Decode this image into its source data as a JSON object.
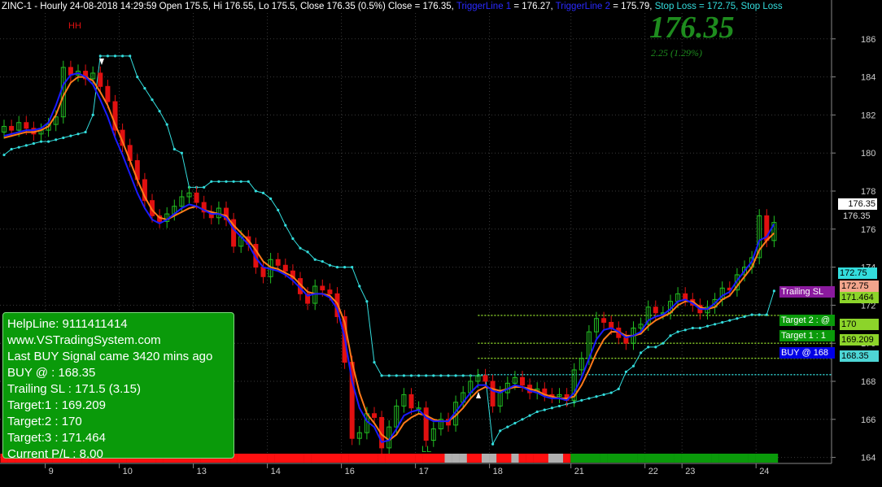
{
  "header": {
    "symbol_info": "ZINC-1 - Hourly 24-08-2018 14:29:59 Open 175.5, Hi 176.55, Lo 175.5, Close 176.35 (0.5%) Close = 176.35, ",
    "tl1_label": "TriggerLine 1",
    "tl1_value": " = 176.27, ",
    "tl2_label": "TriggerLine 2",
    "tl2_value": " = 175.79, ",
    "sl_text": "Stop Loss = 172.75, Stop Loss"
  },
  "price": {
    "last": "176.35",
    "change": "2.25  (1.29%)"
  },
  "info": {
    "helpline": "HelpLine: 9111411414",
    "website": "www.VSTradingSystem.com",
    "signal": " Last BUY Signal came 3420 mins ago",
    "buy": " BUY @  : 168.35",
    "trailing": " Trailing SL : 171.5 (3.15)",
    "target1": " Target:1 : 169.209",
    "target2": " Target:2 : 170",
    "target3": " Target:3 : 171.464",
    "pl": " Current P/L : 8.00"
  },
  "tags": {
    "price_box": "176.35",
    "price_right": "176.35",
    "stop_loss": "172.75",
    "sl2": "172.75",
    "trailing_value": "171.464",
    "trailing_label": "Trailing SL",
    "target2_label": "Target 2 : @",
    "target2_value": "170",
    "target1_label": "Target 1 : 1",
    "target1_value": "169.209",
    "buy_label": "BUY @ 168",
    "buy_value": "168.35"
  },
  "marks": {
    "hh": "HH",
    "ll": "LL"
  },
  "colors": {
    "up": "#22c022",
    "down": "#e01010",
    "trigger1": "#1a1aff",
    "trigger2": "#ff7a1a",
    "stop": "#33dddd",
    "level": "#8cd42a",
    "trailing": "#8b1a9e",
    "buybox": "#0000e6",
    "infobox": "#0a9a0a"
  },
  "chart_data": {
    "type": "candlestick",
    "ylim": [
      163,
      186.5
    ],
    "y_ticks": [
      164,
      166,
      168,
      170,
      172,
      174,
      176,
      178,
      180,
      182,
      184,
      186
    ],
    "x_ticks": [
      {
        "label": "9",
        "i": 6
      },
      {
        "label": "10",
        "i": 16
      },
      {
        "label": "13",
        "i": 26
      },
      {
        "label": "14",
        "i": 36
      },
      {
        "label": "16",
        "i": 46
      },
      {
        "label": "17",
        "i": 56
      },
      {
        "label": "18",
        "i": 66
      },
      {
        "label": "21",
        "i": 77
      },
      {
        "label": "22",
        "i": 87
      },
      {
        "label": "23",
        "i": 92
      },
      {
        "label": "24",
        "i": 102
      }
    ],
    "closes": [
      181.4,
      181.2,
      181.6,
      181.3,
      181.0,
      181.2,
      181.5,
      181.9,
      184.5,
      184.1,
      184.3,
      183.9,
      184.2,
      183.5,
      182.7,
      181.2,
      180.4,
      179.6,
      178.6,
      177.5,
      176.7,
      176.4,
      176.8,
      177.2,
      177.7,
      177.9,
      177.4,
      176.9,
      176.6,
      177.1,
      176.5,
      175.1,
      175.6,
      175.2,
      174.0,
      173.5,
      174.4,
      174.1,
      173.8,
      173.4,
      172.6,
      172.1,
      173.0,
      172.8,
      172.6,
      171.4,
      169.0,
      165.0,
      165.3,
      166.3,
      166.1,
      164.5,
      165.6,
      166.7,
      167.3,
      166.6,
      166.6,
      164.9,
      165.5,
      166.0,
      165.7,
      166.9,
      167.4,
      168.0,
      168.3,
      168.0,
      166.7,
      167.4,
      167.9,
      168.2,
      167.8,
      167.4,
      167.6,
      167.3,
      167.2,
      167.3,
      167.0,
      168.6,
      169.2,
      170.6,
      171.3,
      171.1,
      170.8,
      170.3,
      170.0,
      170.8,
      171.0,
      171.9,
      171.6,
      171.6,
      172.2,
      172.6,
      172.3,
      172.0,
      171.6,
      171.9,
      172.3,
      172.9,
      172.8,
      173.6,
      174.0,
      174.5,
      176.7,
      175.4,
      176.35
    ],
    "trigger1": [
      180.9,
      181.0,
      181.1,
      181.2,
      181.2,
      181.3,
      181.6,
      182.5,
      183.6,
      184.1,
      184.2,
      184.0,
      183.6,
      182.8,
      181.9,
      180.8,
      179.9,
      178.9,
      177.9,
      177.1,
      176.5,
      176.3,
      176.5,
      176.8,
      177.1,
      177.3,
      177.2,
      177.0,
      176.8,
      176.8,
      176.6,
      176.0,
      175.6,
      175.2,
      174.5,
      174.0,
      173.9,
      173.8,
      173.6,
      173.3,
      172.9,
      172.5,
      172.6,
      172.6,
      172.4,
      171.8,
      170.3,
      168.0,
      166.6,
      165.9,
      165.6,
      164.8,
      164.9,
      165.5,
      166.2,
      166.4,
      166.5,
      166.1,
      165.9,
      165.9,
      165.9,
      166.4,
      166.9,
      167.4,
      167.8,
      167.8,
      167.5,
      167.4,
      167.6,
      167.8,
      167.7,
      167.5,
      167.4,
      167.2,
      167.1,
      167.1,
      167.0,
      167.4,
      168.2,
      169.2,
      170.2,
      170.7,
      170.8,
      170.6,
      170.3,
      170.4,
      170.6,
      171.2,
      171.4,
      171.5,
      171.8,
      172.2,
      172.3,
      172.1,
      171.8,
      171.8,
      172.1,
      172.5,
      172.7,
      173.3,
      173.8,
      174.3,
      175.4,
      175.6,
      176.27
    ],
    "trigger2": [
      180.8,
      180.9,
      181.0,
      181.1,
      181.1,
      181.2,
      181.4,
      182.0,
      183.0,
      183.7,
      184.0,
      184.0,
      183.8,
      183.2,
      182.5,
      181.5,
      180.6,
      179.6,
      178.6,
      177.7,
      177.0,
      176.6,
      176.5,
      176.7,
      176.9,
      177.1,
      177.2,
      177.0,
      176.9,
      176.8,
      176.7,
      176.2,
      175.8,
      175.4,
      174.9,
      174.3,
      174.0,
      173.9,
      173.7,
      173.5,
      173.1,
      172.7,
      172.6,
      172.6,
      172.5,
      172.1,
      171.1,
      169.0,
      167.4,
      166.3,
      165.8,
      165.2,
      164.9,
      165.2,
      165.8,
      166.1,
      166.3,
      166.2,
      166.0,
      165.9,
      165.9,
      166.2,
      166.6,
      167.1,
      167.5,
      167.7,
      167.6,
      167.5,
      167.6,
      167.7,
      167.7,
      167.6,
      167.5,
      167.3,
      167.2,
      167.1,
      167.1,
      167.2,
      167.8,
      168.6,
      169.5,
      170.2,
      170.6,
      170.6,
      170.4,
      170.4,
      170.5,
      170.9,
      171.2,
      171.4,
      171.6,
      172.0,
      172.2,
      172.2,
      171.9,
      171.8,
      171.9,
      172.3,
      172.5,
      173.0,
      173.5,
      174.0,
      174.9,
      175.4,
      175.79
    ],
    "stop_loss": [
      179.9,
      180.2,
      180.3,
      180.4,
      180.5,
      180.6,
      180.6,
      180.7,
      180.8,
      180.9,
      181.0,
      181.1,
      182.0,
      185.1,
      185.1,
      185.1,
      185.1,
      185.1,
      184.0,
      183.4,
      182.8,
      182.2,
      181.5,
      180.2,
      180.0,
      178.2,
      178.2,
      178.2,
      178.5,
      178.5,
      178.5,
      178.5,
      178.5,
      178.5,
      178.0,
      177.9,
      177.6,
      177.0,
      176.2,
      175.5,
      175.0,
      174.8,
      174.4,
      174.3,
      174.1,
      174.0,
      174.0,
      174.0,
      173.0,
      172.2,
      169.0,
      168.3,
      168.3,
      168.3,
      168.3,
      168.3,
      168.3,
      168.3,
      168.3,
      168.3,
      168.3,
      168.3,
      168.3,
      168.3,
      168.3,
      168.3,
      164.7,
      165.4,
      165.6,
      165.8,
      166.0,
      166.2,
      166.4,
      166.5,
      166.6,
      166.7,
      166.8,
      166.9,
      167.0,
      167.1,
      167.2,
      167.3,
      167.4,
      167.6,
      168.5,
      168.8,
      169.5,
      169.8,
      169.8,
      170.0,
      170.4,
      170.6,
      170.7,
      170.8,
      170.8,
      170.9,
      171.0,
      171.1,
      171.2,
      171.3,
      171.4,
      171.5,
      171.5,
      171.5,
      172.75
    ],
    "levels": {
      "trailing_sl": 171.464,
      "target2": 170,
      "target1": 169.209,
      "buy": 168.35
    },
    "signal_bar_colors": [
      "red",
      "red",
      "red",
      "red",
      "red",
      "red",
      "red",
      "red",
      "red",
      "red",
      "red",
      "red",
      "red",
      "red",
      "red",
      "red",
      "red",
      "red",
      "red",
      "red",
      "red",
      "red",
      "red",
      "red",
      "red",
      "red",
      "red",
      "red",
      "red",
      "red",
      "red",
      "red",
      "red",
      "red",
      "red",
      "red",
      "red",
      "red",
      "red",
      "red",
      "red",
      "red",
      "red",
      "red",
      "red",
      "red",
      "red",
      "red",
      "red",
      "red",
      "red",
      "red",
      "red",
      "red",
      "red",
      "red",
      "red",
      "red",
      "red",
      "red",
      "gray",
      "gray",
      "gray",
      "red",
      "red",
      "gray",
      "gray",
      "red",
      "red",
      "gray",
      "red",
      "red",
      "red",
      "red",
      "gray",
      "gray",
      "red",
      "green",
      "green",
      "green",
      "green",
      "green",
      "green",
      "green",
      "green",
      "green",
      "green",
      "green",
      "green",
      "green",
      "green",
      "green",
      "green",
      "green",
      "green",
      "green",
      "green",
      "green",
      "green",
      "green",
      "green",
      "green",
      "green",
      "green",
      "green"
    ]
  }
}
